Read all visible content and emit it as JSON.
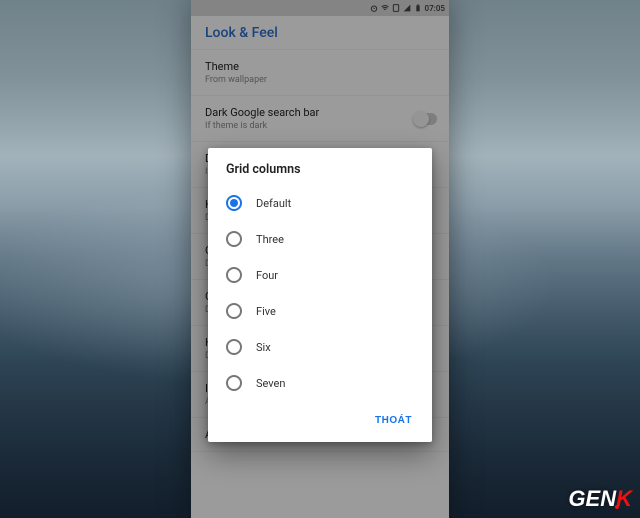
{
  "statusbar": {
    "time": "07:05"
  },
  "appbar": {
    "title": "Look & Feel"
  },
  "settings": [
    {
      "title": "Theme",
      "subtitle": "From wallpaper",
      "switch": false
    },
    {
      "title": "Dark Google search bar",
      "subtitle": "If theme is dark",
      "switch": true
    },
    {
      "title": "Dark app search bar",
      "subtitle": "If theme is dark",
      "switch": false
    },
    {
      "title": "Home screen grid",
      "subtitle": "Default",
      "switch": false
    },
    {
      "title": "Grid columns",
      "subtitle": "Default",
      "switch": false
    },
    {
      "title": "Grid rows",
      "subtitle": "Default",
      "switch": false
    },
    {
      "title": "Hotseat columns",
      "subtitle": "Default",
      "switch": false
    },
    {
      "title": "Icon size",
      "subtitle": "Average",
      "switch": false
    },
    {
      "title": "Allow rotation",
      "subtitle": "",
      "switch": false
    }
  ],
  "dialog": {
    "title": "Grid columns",
    "selected": 0,
    "options": [
      "Default",
      "Three",
      "Four",
      "Five",
      "Six",
      "Seven"
    ],
    "dismiss": "THOÁT"
  },
  "watermark": {
    "a": "GEN",
    "b": "K"
  }
}
